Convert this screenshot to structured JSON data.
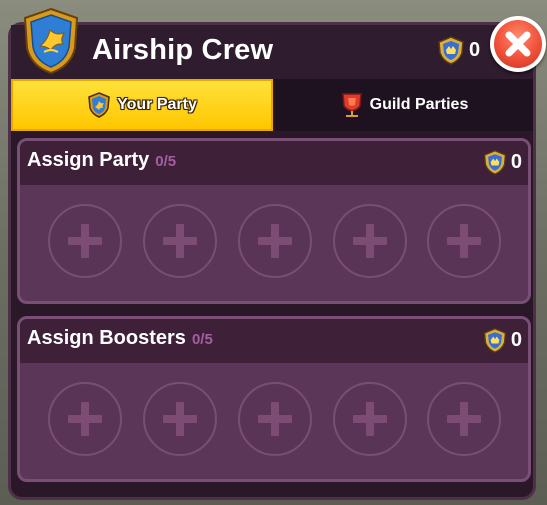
{
  "header": {
    "title": "Airship Crew",
    "gold_count": "0",
    "close_icon": "close-icon"
  },
  "tabs": [
    {
      "label": "Your Party",
      "icon": "shield-emblem-icon",
      "active": true
    },
    {
      "label": "Guild Parties",
      "icon": "guild-banner-icon",
      "active": false
    }
  ],
  "sections": [
    {
      "title": "Assign Party",
      "count": "0/5",
      "gold": "0",
      "slots": 5
    },
    {
      "title": "Assign Boosters",
      "count": "0/5",
      "gold": "0",
      "slots": 5
    }
  ],
  "colors": {
    "tab_active": "#ffd000",
    "panel": "#2a1828",
    "section": "#5c3658",
    "close": "#f0503a"
  }
}
